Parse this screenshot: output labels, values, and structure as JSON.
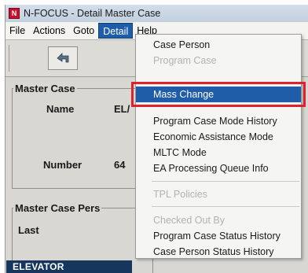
{
  "window": {
    "title": "N-FOCUS - Detail Master Case",
    "app_icon_letter": "N"
  },
  "menubar": {
    "items": [
      "File",
      "Actions",
      "Goto",
      "Detail",
      "Help"
    ],
    "active": "Detail"
  },
  "master_case": {
    "group_title": "Master Case",
    "name_label": "Name",
    "name_value": "EL/",
    "number_label": "Number",
    "number_value": "64"
  },
  "persons": {
    "group_title": "Master Case Pers",
    "last_label": "Last",
    "grid_first_cell": "ELEVATOR"
  },
  "detail_menu": {
    "items": [
      {
        "label": "Case Person",
        "disabled": false
      },
      {
        "label": "Program Case",
        "disabled": true
      },
      {
        "label": "Mass Change",
        "disabled": false,
        "highlight": true
      },
      {
        "label": "Program Case Mode History",
        "disabled": false
      },
      {
        "label": "Economic Assistance Mode",
        "disabled": false
      },
      {
        "label": "MLTC Mode",
        "disabled": false
      },
      {
        "label": "EA Processing Queue Info",
        "disabled": false
      },
      {
        "label": "TPL Policies",
        "disabled": true
      },
      {
        "label": "Checked Out By",
        "disabled": true
      },
      {
        "label": "Program Case Status History",
        "disabled": false
      },
      {
        "label": "Case Person Status History",
        "disabled": false
      }
    ]
  },
  "colors": {
    "highlight": "#1f5da8",
    "annotation_box": "#e0202a",
    "grid_header": "#17365d"
  }
}
